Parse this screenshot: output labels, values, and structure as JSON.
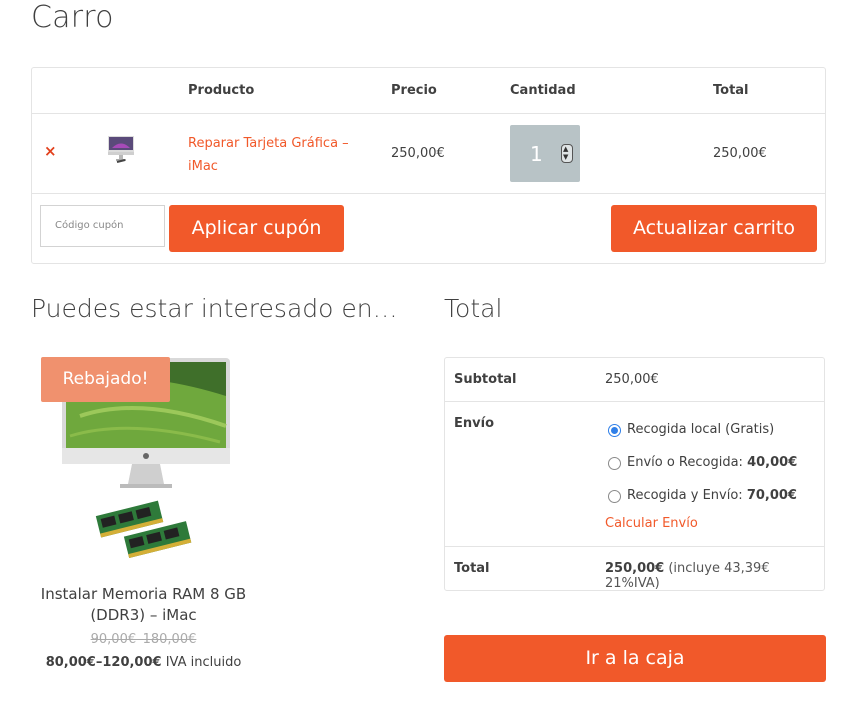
{
  "page": {
    "title": "Carro"
  },
  "cart": {
    "headers": {
      "product": "Producto",
      "price": "Precio",
      "quantity": "Cantidad",
      "total": "Total"
    },
    "items": [
      {
        "remove": "×",
        "name": "Reparar Tarjeta Gráfica – iMac",
        "price": "250,00€",
        "quantity": "1",
        "total": "250,00€"
      }
    ],
    "coupon_placeholder": "Código cupón",
    "apply_coupon_label": "Aplicar cupón",
    "update_cart_label": "Actualizar carrito"
  },
  "related": {
    "title": "Puedes estar interesado en…",
    "product": {
      "badge": "Rebajado!",
      "name": "Instalar Memoria RAM 8 GB (DDR3) – iMac",
      "old_price": "90,00€–180,00€",
      "new_price": "80,00€–120,00€",
      "tax_note": "IVA incluido"
    }
  },
  "totals": {
    "title": "Total",
    "subtotal_label": "Subtotal",
    "subtotal_value": "250,00€",
    "shipping_label": "Envío",
    "shipping_options": [
      {
        "label": "Recogida local (Gratis)",
        "price": "",
        "selected": true
      },
      {
        "label": "Envío o Recogida: ",
        "price": "40,00€",
        "selected": false
      },
      {
        "label": "Recogida y Envío: ",
        "price": "70,00€",
        "selected": false
      }
    ],
    "calc_shipping": "Calcular Envío",
    "total_label": "Total",
    "total_value": "250,00€",
    "total_note": "(incluye 43,39€ 21%IVA)",
    "checkout_label": "Ir a la caja"
  },
  "colors": {
    "accent": "#f1592a",
    "badge": "#f0916e",
    "quantity_bg": "#b8c3c6",
    "radio_checked": "#2f7fe8"
  }
}
